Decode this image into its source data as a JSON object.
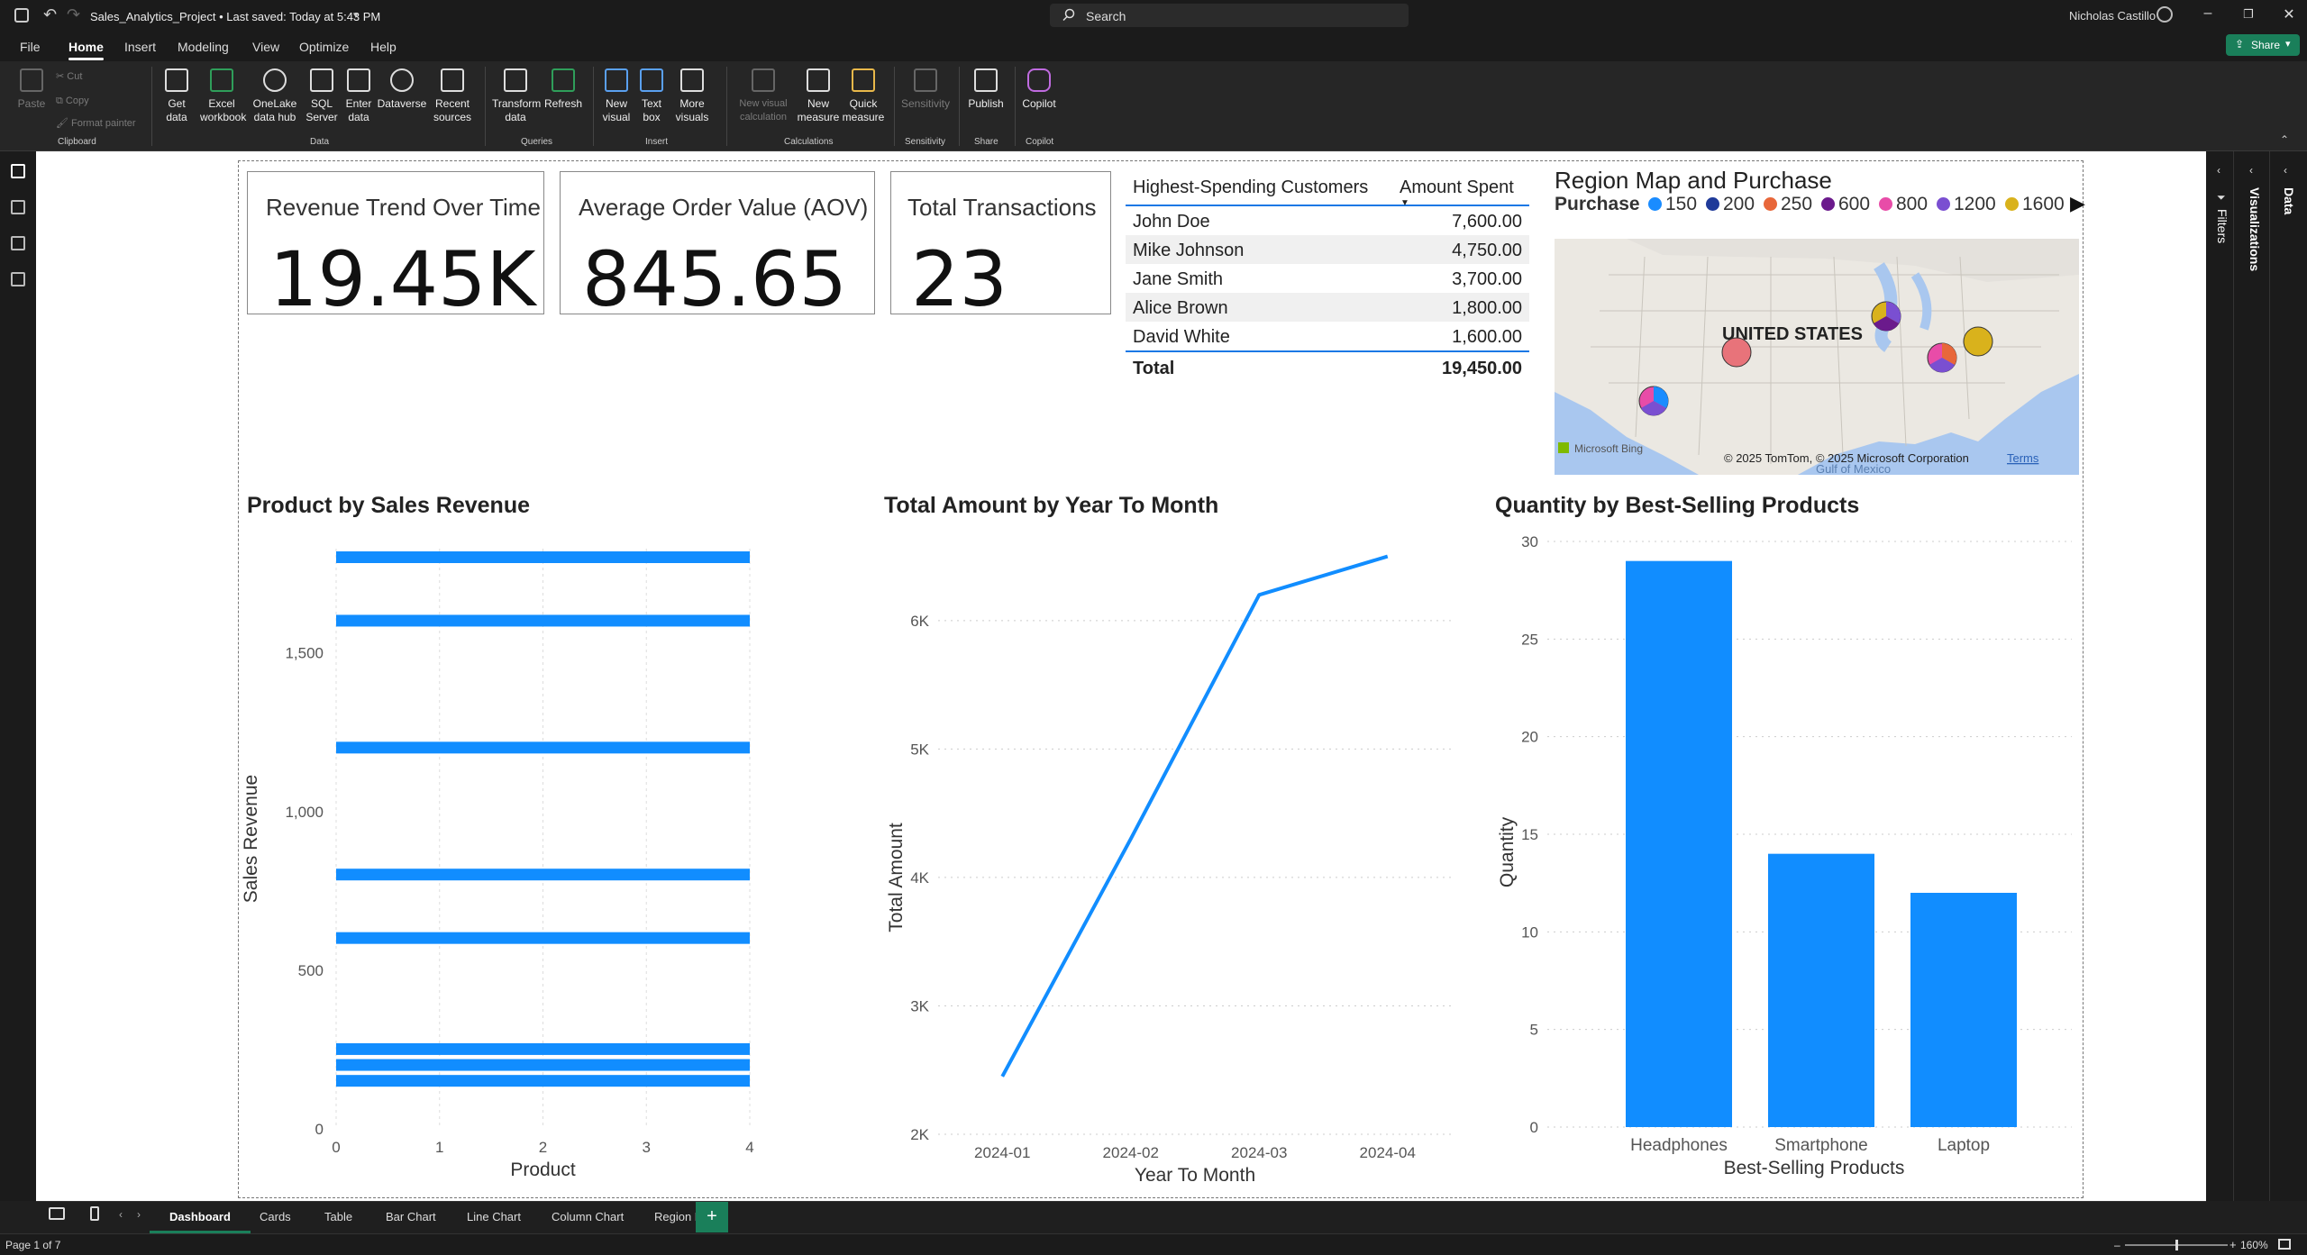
{
  "titlebar": {
    "title": "Sales_Analytics_Project • Last saved: Today at 5:43 PM",
    "search_placeholder": "Search",
    "user_name": "Nicholas Castillo"
  },
  "menu": {
    "items": [
      "File",
      "Home",
      "Insert",
      "Modeling",
      "View",
      "Optimize",
      "Help"
    ],
    "active": "Home",
    "share_label": "Share"
  },
  "ribbon": {
    "clipboard": {
      "paste": "Paste",
      "cut": "Cut",
      "copy": "Copy",
      "format_painter": "Format painter",
      "group": "Clipboard"
    },
    "data": {
      "get_data": "Get data",
      "excel": "Excel workbook",
      "onelake": "OneLake data hub",
      "sql": "SQL Server",
      "enter": "Enter data",
      "dataverse": "Dataverse",
      "recent": "Recent sources",
      "group": "Data"
    },
    "queries": {
      "transform": "Transform data",
      "refresh": "Refresh",
      "group": "Queries"
    },
    "insert": {
      "new_visual": "New visual",
      "text_box": "Text box",
      "more_visuals": "More visuals",
      "group": "Insert"
    },
    "calculations": {
      "new_visual_calc": "New visual calculation",
      "new_measure": "New measure",
      "quick_measure": "Quick measure",
      "group": "Calculations"
    },
    "sensitivity": {
      "label": "Sensitivity",
      "group": "Sensitivity"
    },
    "share": {
      "publish": "Publish",
      "group": "Share"
    },
    "copilot": {
      "label": "Copilot",
      "group": "Copilot"
    }
  },
  "cards": [
    {
      "title": "Revenue Trend Over Time",
      "value": "19.45K"
    },
    {
      "title": "Average Order Value (AOV)",
      "value": "845.65"
    },
    {
      "title": "Total Transactions",
      "value": "23"
    }
  ],
  "customers_table": {
    "headers": [
      "Highest-Spending Customers",
      "Amount Spent"
    ],
    "rows": [
      {
        "name": "John Doe",
        "amount": "7,600.00"
      },
      {
        "name": "Mike Johnson",
        "amount": "4,750.00"
      },
      {
        "name": "Jane Smith",
        "amount": "3,700.00"
      },
      {
        "name": "Alice Brown",
        "amount": "1,800.00"
      },
      {
        "name": "David White",
        "amount": "1,600.00"
      }
    ],
    "total_label": "Total",
    "total_value": "19,450.00"
  },
  "map": {
    "title": "Region Map and Purchase",
    "legend_title": "Purchase",
    "legend": [
      {
        "label": "150",
        "color": "#1a8cff"
      },
      {
        "label": "200",
        "color": "#1f3a99"
      },
      {
        "label": "250",
        "color": "#e8673a"
      },
      {
        "label": "600",
        "color": "#6b1a8c"
      },
      {
        "label": "800",
        "color": "#e84ca8"
      },
      {
        "label": "1200",
        "color": "#7a4fd1"
      },
      {
        "label": "1600",
        "color": "#d9b21c"
      }
    ],
    "country_label": "UNITED STATES",
    "gulf_label": "Gulf of Mexico",
    "bing_label": "Microsoft Bing",
    "copyright": "© 2025 TomTom, © 2025 Microsoft Corporation",
    "terms": "Terms"
  },
  "chart_data": [
    {
      "type": "bar",
      "title": "Product by Sales Revenue",
      "xlabel": "Product",
      "ylabel": "Sales Revenue",
      "x_ticks": [
        "0",
        "1",
        "2",
        "3",
        "4"
      ],
      "y_ticks": [
        "0",
        "500",
        "1,000",
        "1,500"
      ],
      "ylim": [
        0,
        1800
      ],
      "values": [
        1800,
        1600,
        1200,
        800,
        600,
        250,
        200,
        150
      ],
      "color": "#118dff"
    },
    {
      "type": "line",
      "title": "Total Amount by Year To Month",
      "xlabel": "Year To Month",
      "ylabel": "Total Amount",
      "categories": [
        "2024-01",
        "2024-02",
        "2024-03",
        "2024-04"
      ],
      "values": [
        2450,
        4300,
        6200,
        6500
      ],
      "y_ticks": [
        "2K",
        "3K",
        "4K",
        "5K",
        "6K"
      ],
      "ylim": [
        2000,
        6500
      ],
      "color": "#118dff"
    },
    {
      "type": "bar",
      "title": "Quantity by Best-Selling Products",
      "xlabel": "Best-Selling Products",
      "ylabel": "Quantity",
      "categories": [
        "Headphones",
        "Smartphone",
        "Laptop"
      ],
      "values": [
        29,
        14,
        12
      ],
      "y_ticks": [
        "0",
        "5",
        "10",
        "15",
        "20",
        "25",
        "30"
      ],
      "ylim": [
        0,
        30
      ],
      "color": "#118dff"
    }
  ],
  "right_panes": {
    "visualizations": "Visualizations",
    "data": "Data",
    "filters": "Filters"
  },
  "tabs": {
    "items": [
      "Dashboard",
      "Cards",
      "Table",
      "Bar Chart",
      "Line Chart",
      "Column Chart",
      "Region Map"
    ],
    "active": "Dashboard",
    "add": "+"
  },
  "status": {
    "page": "Page 1 of 7",
    "zoom": "160%"
  }
}
